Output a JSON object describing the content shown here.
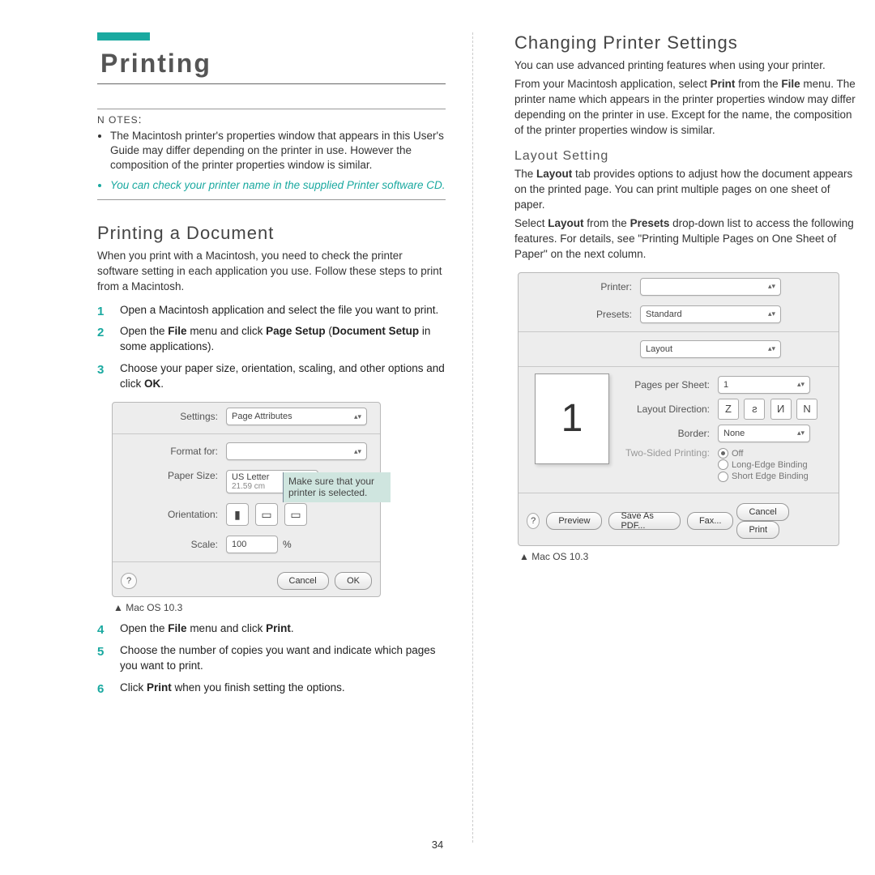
{
  "page_number": "34",
  "left": {
    "title": "Printing",
    "notes_label": "N OTES",
    "notes": {
      "n1": "The Macintosh printer's properties window that appears in this User's Guide may differ depending on the printer in use. However the composition of the printer properties window is similar.",
      "n2": "You can check your printer name in the supplied Printer software CD."
    },
    "section1": "Printing a Document",
    "section1_body": "When you print with a Macintosh, you need to check the printer software setting in each application you use. Follow these steps to print from a Macintosh.",
    "steps": {
      "s1": "Open a Macintosh application and select the file you want to print.",
      "s2a": "Open the ",
      "s2b": "File",
      "s2c": " menu and click ",
      "s2d": "Page Setup",
      "s2e": " (",
      "s2f": "Document Setup",
      "s2g": " in some applications).",
      "s3a": "Choose your paper size, orientation, scaling, and other options and click ",
      "s3b": "OK",
      "s3c": ".",
      "s4a": "Open the ",
      "s4b": "File",
      "s4c": " menu and click ",
      "s4d": "Print",
      "s4e": ".",
      "s5": "Choose the number of copies you want and indicate which pages you want to print.",
      "s6a": "Click ",
      "s6b": "Print",
      "s6c": " when you finish setting the options."
    },
    "dlg1": {
      "settings_label": "Settings:",
      "settings_value": "Page Attributes",
      "format_label": "Format for:",
      "format_value": "",
      "paper_label": "Paper Size:",
      "paper_value": "US Letter",
      "paper_sub": "21.59 cm",
      "orientation_label": "Orientation:",
      "scale_label": "Scale:",
      "scale_value": "100",
      "scale_unit": "%",
      "callout": "Make sure that your printer is selected.",
      "cancel": "Cancel",
      "ok": "OK",
      "help": "?"
    },
    "caption1": "Mac OS 10.3"
  },
  "right": {
    "section2": "Changing Printer Settings",
    "body1": "You can use advanced printing features when using your printer.",
    "body2a": "From your Macintosh application, select ",
    "body2b": "Print",
    "body2c": " from the ",
    "body2d": "File",
    "body2e": " menu. The printer name which appears in the printer properties window may differ depending on the printer in use. Except for the name, the composition of the printer properties window is similar.",
    "subsection": "Layout Setting",
    "body3a": "The ",
    "body3b": "Layout",
    "body3c": " tab provides options to adjust how the document appears on the printed page. You can print multiple pages on one sheet of paper.",
    "body4a": "Select ",
    "body4b": "Layout",
    "body4c": " from the ",
    "body4d": "Presets",
    "body4e": " drop-down list to access the following features. For details, see \"Printing Multiple Pages on One Sheet of Paper\" on the next column.",
    "dlg2": {
      "printer_label": "Printer:",
      "printer_value": "",
      "presets_label": "Presets:",
      "presets_value": "Standard",
      "panel_value": "Layout",
      "pps_label": "Pages per Sheet:",
      "pps_value": "1",
      "dir_label": "Layout Direction:",
      "border_label": "Border:",
      "border_value": "None",
      "tsp_label": "Two-Sided Printing:",
      "tsp_off": "Off",
      "tsp_long": "Long-Edge Binding",
      "tsp_short": "Short Edge Binding",
      "preview_btn": "Preview",
      "save_pdf_btn": "Save As PDF...",
      "fax_btn": "Fax...",
      "cancel": "Cancel",
      "print": "Print",
      "help": "?",
      "big_one": "1"
    },
    "caption2": "Mac OS 10.3"
  }
}
